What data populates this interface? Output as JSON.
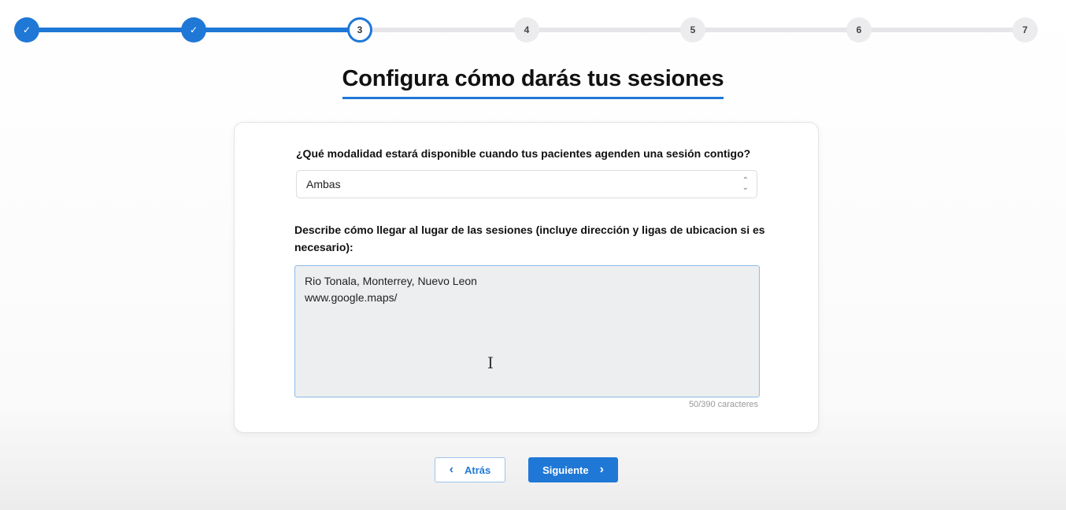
{
  "stepper": {
    "steps": [
      {
        "label": "✓",
        "state": "done"
      },
      {
        "label": "✓",
        "state": "done"
      },
      {
        "label": "3",
        "state": "current"
      },
      {
        "label": "4",
        "state": "todo"
      },
      {
        "label": "5",
        "state": "todo"
      },
      {
        "label": "6",
        "state": "todo"
      },
      {
        "label": "7",
        "state": "todo"
      }
    ],
    "accent_color": "#1f78d6"
  },
  "page": {
    "title": "Configura cómo darás tus sesiones"
  },
  "form": {
    "modality_question": "¿Qué modalidad estará disponible cuando tus pacientes agenden una sesión contigo?",
    "modality_value": "Ambas",
    "directions_question": "Describe cómo llegar al lugar de las sesiones (incluye dirección y ligas de ubicacion si es necesario):",
    "directions_lines": [
      "Rio Tonala, Monterrey, Nuevo Leon",
      "www.google.maps/"
    ],
    "char_counter": "50/390 caracteres"
  },
  "nav": {
    "back_label": "Atrás",
    "next_label": "Siguiente"
  }
}
